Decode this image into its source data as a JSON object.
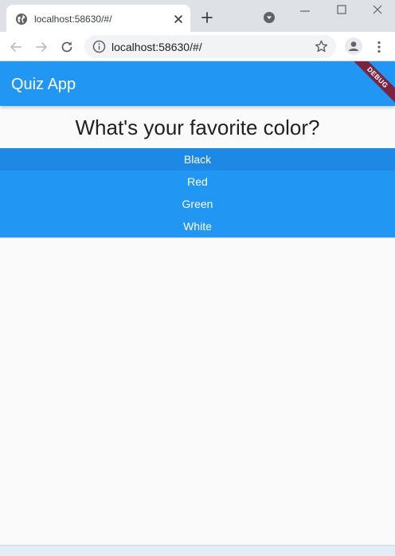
{
  "browser": {
    "tab_title": "localhost:58630/#/",
    "url": "localhost:58630/#/"
  },
  "app": {
    "title": "Quiz App",
    "debug_label": "DEBUG",
    "accent_color": "#2196f3",
    "question": "What's your favorite color?",
    "answers": [
      "Black",
      "Red",
      "Green",
      "White"
    ]
  }
}
